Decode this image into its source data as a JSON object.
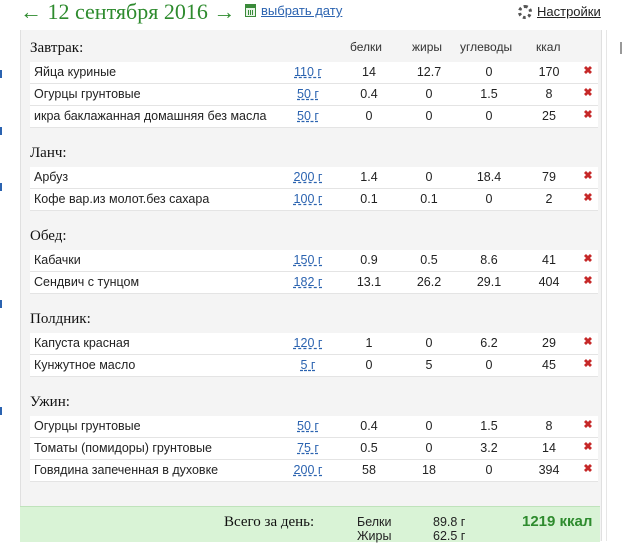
{
  "header": {
    "prev_arrow": "←",
    "date": "12 сентября 2016",
    "next_arrow": "→",
    "pick_date_label": "выбрать дату",
    "settings_label": "Настройки"
  },
  "columns": {
    "protein": "белки",
    "fat": "жиры",
    "carbs": "углеводы",
    "kcal": "ккал"
  },
  "meals": [
    {
      "title": "Завтрак:",
      "items": [
        {
          "name": "Яйца куриные",
          "amount": "110 г",
          "protein": "14",
          "fat": "12.7",
          "carbs": "0",
          "kcal": "170"
        },
        {
          "name": "Огурцы грунтовые",
          "amount": "50 г",
          "protein": "0.4",
          "fat": "0",
          "carbs": "1.5",
          "kcal": "8"
        },
        {
          "name": "икра баклажанная домашняя без масла",
          "amount": "50 г",
          "protein": "0",
          "fat": "0",
          "carbs": "0",
          "kcal": "25"
        }
      ]
    },
    {
      "title": "Ланч:",
      "items": [
        {
          "name": "Арбуз",
          "amount": "200 г",
          "protein": "1.4",
          "fat": "0",
          "carbs": "18.4",
          "kcal": "79"
        },
        {
          "name": "Кофе вар.из молот.без сахара",
          "amount": "100 г",
          "protein": "0.1",
          "fat": "0.1",
          "carbs": "0",
          "kcal": "2"
        }
      ]
    },
    {
      "title": "Обед:",
      "items": [
        {
          "name": "Кабачки",
          "amount": "150 г",
          "protein": "0.9",
          "fat": "0.5",
          "carbs": "8.6",
          "kcal": "41"
        },
        {
          "name": "Сендвич с тунцом",
          "amount": "182 г",
          "protein": "13.1",
          "fat": "26.2",
          "carbs": "29.1",
          "kcal": "404"
        }
      ]
    },
    {
      "title": "Полдник:",
      "items": [
        {
          "name": "Капуста красная",
          "amount": "120 г",
          "protein": "1",
          "fat": "0",
          "carbs": "6.2",
          "kcal": "29"
        },
        {
          "name": "Кунжутное масло",
          "amount": "5 г",
          "protein": "0",
          "fat": "5",
          "carbs": "0",
          "kcal": "45"
        }
      ]
    },
    {
      "title": "Ужин:",
      "items": [
        {
          "name": "Огурцы грунтовые",
          "amount": "50 г",
          "protein": "0.4",
          "fat": "0",
          "carbs": "1.5",
          "kcal": "8"
        },
        {
          "name": "Томаты (помидоры) грунтовые",
          "amount": "75 г",
          "protein": "0.5",
          "fat": "0",
          "carbs": "3.2",
          "kcal": "14"
        },
        {
          "name": "Говядина запеченная в духовке",
          "amount": "200 г",
          "protein": "58",
          "fat": "18",
          "carbs": "0",
          "kcal": "394"
        }
      ]
    }
  ],
  "delete_glyph": "✖",
  "totals": {
    "label": "Всего за день:",
    "protein_label": "Белки",
    "protein_value": "89.8 г",
    "fat_label": "Жиры",
    "fat_value": "62.5 г",
    "kcal": "1219 ккал"
  },
  "colors": {
    "accent_green": "#2e8b2e",
    "link_blue": "#2b63b0",
    "delete_red": "#c62828",
    "totals_bg": "#d9f3d6"
  }
}
